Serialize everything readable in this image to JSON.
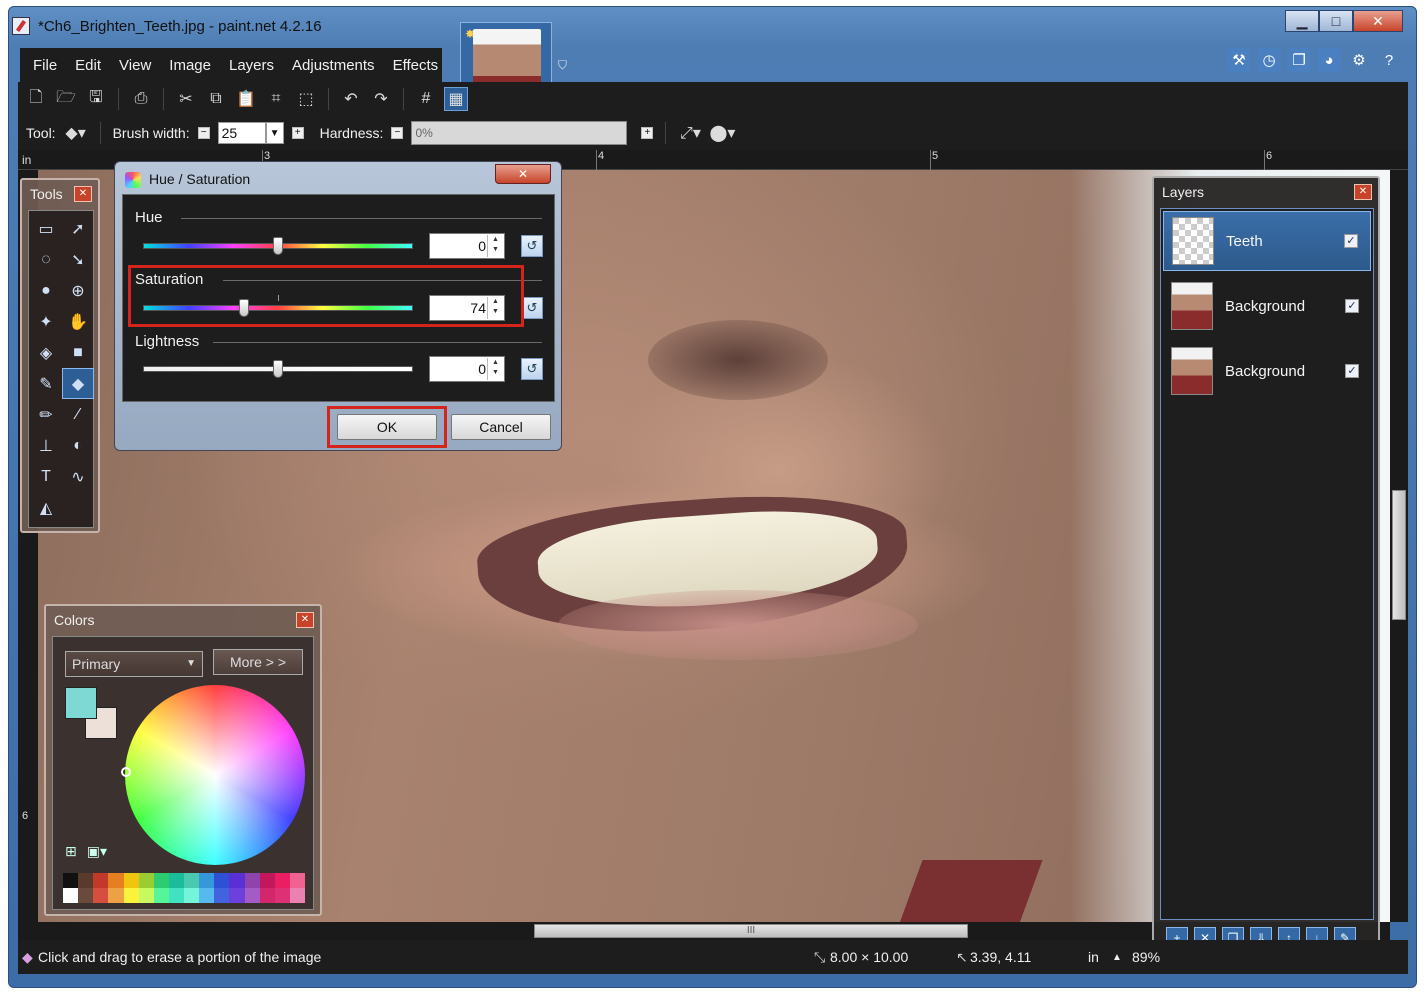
{
  "window": {
    "title": "*Ch6_Brighten_Teeth.jpg - paint.net 4.2.16",
    "controls": {
      "minimize": "▁",
      "maximize": "□",
      "close": "✕"
    }
  },
  "menu": [
    "File",
    "Edit",
    "View",
    "Image",
    "Layers",
    "Adjustments",
    "Effects"
  ],
  "toolbar_options": {
    "tool_label": "Tool:",
    "brush_width_label": "Brush width:",
    "brush_width_value": "25",
    "hardness_label": "Hardness:",
    "hardness_value": "0%"
  },
  "rulers": {
    "unit": "in",
    "top_labels": [
      "3",
      "4",
      "5",
      "6"
    ],
    "left_labels": [
      "6"
    ]
  },
  "tools_panel": {
    "title": "Tools",
    "active_tool": "eraser-tool"
  },
  "colors_panel": {
    "title": "Colors",
    "mode_select": "Primary",
    "more_button": "More > >",
    "primary_color": "#7ed9d4",
    "secondary_color": "#ece0d8",
    "palette": [
      "#111111",
      "#5a3a2a",
      "#c0392b",
      "#e67e22",
      "#f1c40f",
      "#9acd32",
      "#2ecc71",
      "#1abc9c",
      "#48c9b0",
      "#3498db",
      "#2e4fd6",
      "#5b2fd6",
      "#8e44ad",
      "#c2185b",
      "#e91e63",
      "#f06292"
    ]
  },
  "layers_panel": {
    "title": "Layers",
    "layers": [
      {
        "name": "Teeth",
        "visible": true,
        "selected": true,
        "thumb": "transparent"
      },
      {
        "name": "Background",
        "visible": true,
        "selected": false,
        "thumb": "photo"
      },
      {
        "name": "Background",
        "visible": true,
        "selected": false,
        "thumb": "photo"
      }
    ]
  },
  "dialog": {
    "title": "Hue / Saturation",
    "hue": {
      "label": "Hue",
      "value": "0"
    },
    "saturation": {
      "label": "Saturation",
      "value": "74"
    },
    "lightness": {
      "label": "Lightness",
      "value": "0"
    },
    "ok": "OK",
    "cancel": "Cancel",
    "highlight_color": "#d4241c"
  },
  "status": {
    "hint": "Click and drag to erase a portion of the image",
    "image_size": "8.00 × 10.00",
    "cursor_pos": "3.39, 4.11",
    "unit": "in",
    "zoom": "89%"
  },
  "scrollbar_grip": "III"
}
